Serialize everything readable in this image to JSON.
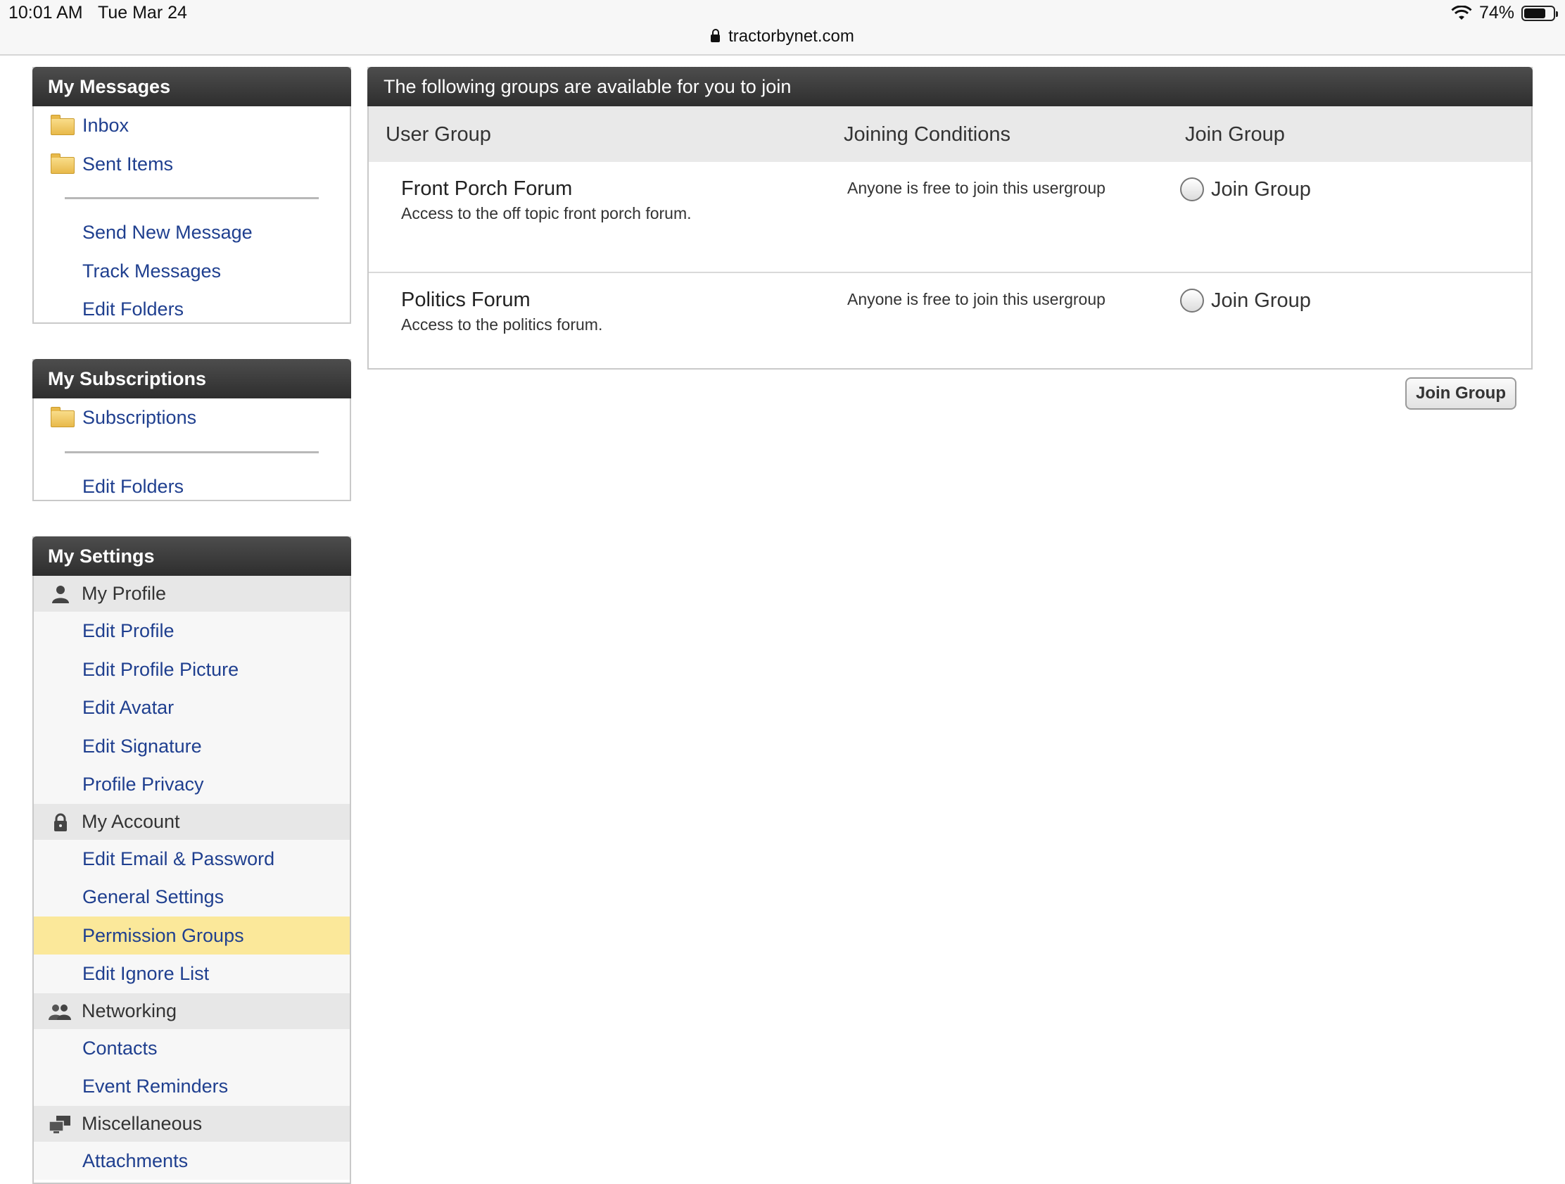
{
  "status_bar": {
    "time": "10:01 AM",
    "date": "Tue Mar 24",
    "battery": "74%",
    "battery_level": 0.74
  },
  "address_bar": {
    "domain": "tractorbynet.com"
  },
  "sidebar": {
    "messages": {
      "title": "My Messages",
      "folders": [
        "Inbox",
        "Sent Items"
      ],
      "links": [
        "Send New Message",
        "Track Messages",
        "Edit Folders"
      ]
    },
    "subscriptions": {
      "title": "My Subscriptions",
      "folders": [
        "Subscriptions"
      ],
      "links": [
        "Edit Folders"
      ]
    },
    "settings": {
      "title": "My Settings",
      "sections": [
        {
          "label": "My Profile",
          "icon": "user-icon",
          "links": [
            "Edit Profile",
            "Edit Profile Picture",
            "Edit Avatar",
            "Edit Signature",
            "Profile Privacy"
          ]
        },
        {
          "label": "My Account",
          "icon": "padlock-icon",
          "links": [
            "Edit Email & Password",
            "General Settings",
            "Permission Groups",
            "Edit Ignore List"
          ]
        },
        {
          "label": "Networking",
          "icon": "people-icon",
          "links": [
            "Contacts",
            "Event Reminders"
          ]
        },
        {
          "label": "Miscellaneous",
          "icon": "computers-icon",
          "links": [
            "Attachments"
          ]
        }
      ],
      "active_link": "Permission Groups"
    }
  },
  "main": {
    "title": "The following groups are available for you to join",
    "columns": [
      "User Group",
      "Joining Conditions",
      "Join Group"
    ],
    "groups": [
      {
        "name": "Front Porch Forum",
        "description": "Access to the off topic front porch forum.",
        "condition": "Anyone is free to join this usergroup",
        "join_label": "Join Group"
      },
      {
        "name": "Politics Forum",
        "description": "Access to the politics forum.",
        "condition": "Anyone is free to join this usergroup",
        "join_label": "Join Group"
      }
    ],
    "submit_label": "Join Group"
  }
}
